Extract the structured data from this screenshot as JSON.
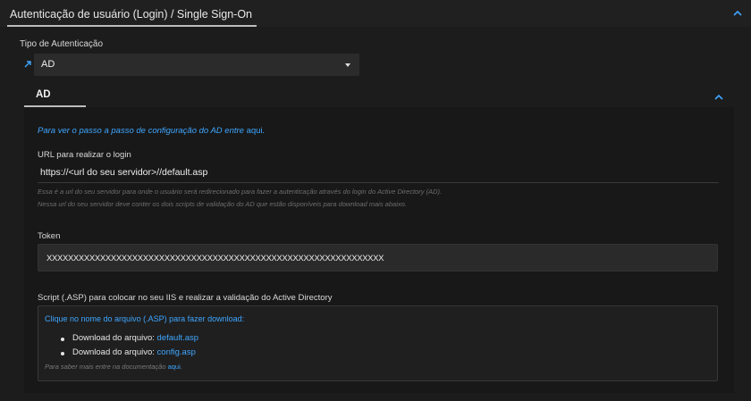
{
  "section": {
    "title": "Autenticação de usuário (Login) / Single Sign-On",
    "collapse_icon": "chevron-up-icon"
  },
  "auth_type": {
    "label": "Tipo de Autenticação",
    "link_icon": "external-link-arrow-icon",
    "selected_value": "AD"
  },
  "ad_panel": {
    "title": "AD",
    "intro_text": "Para ver o passo a passo de configuração do AD entre",
    "intro_link": "aqui",
    "intro_end": ".",
    "url_field": {
      "label": "URL para realizar o login",
      "value": "https://<url do seu servidor>//default.asp",
      "help_line1": "Essa é a url do seu servidor para onde o usuário será redirecionado para fazer a autenticação através do login do Active Directory (AD).",
      "help_line2": "Nessa url do seu servidor deve conter os dois scripts de validação do AD que estão disponíveis para download mais abaixo."
    },
    "token_field": {
      "label": "Token",
      "value": "XXXXXXXXXXXXXXXXXXXXXXXXXXXXXXXXXXXXXXXXXXXXXXXXXXXXXXXXXXXXXXX"
    },
    "script": {
      "label": "Script (.ASP) para colocar no seu IIS e realizar a validação do Active Directory",
      "instruction": "Clique no nome do arquivo (.ASP) para fazer download:",
      "downloads": [
        {
          "prefix": "Download do arquivo:",
          "file": "default.asp"
        },
        {
          "prefix": "Download do arquivo:",
          "file": "config.asp"
        }
      ],
      "docs_text": "Para saber mais entre na documentação",
      "docs_link": "aqui",
      "docs_end": "."
    }
  },
  "colors": {
    "background": "#1c1c1c",
    "panel": "#181818",
    "accent": "#3ea6ff",
    "input_bg": "#2b2b2b"
  }
}
